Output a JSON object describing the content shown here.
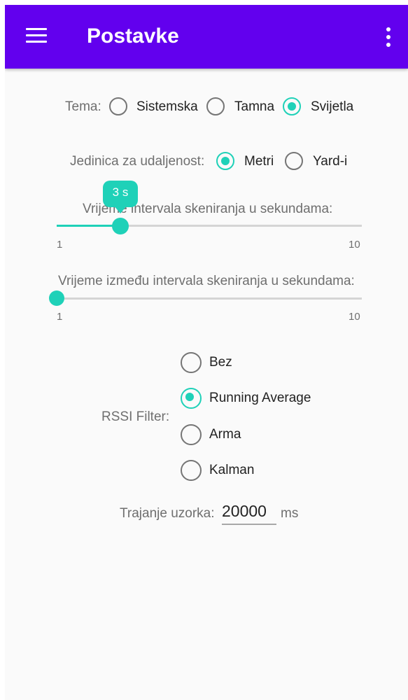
{
  "appbar": {
    "title": "Postavke"
  },
  "theme": {
    "label": "Tema:",
    "options": [
      {
        "label": "Sistemska",
        "selected": false
      },
      {
        "label": "Tamna",
        "selected": false
      },
      {
        "label": "Svijetla",
        "selected": true
      }
    ]
  },
  "distance_unit": {
    "label": "Jedinica za udaljenost:",
    "options": [
      {
        "label": "Metri",
        "selected": true
      },
      {
        "label": "Yard-i",
        "selected": false
      }
    ]
  },
  "scan_interval": {
    "label": "Vrijeme intervala skeniranja u sekundama:",
    "value_bubble": "3 s",
    "value": 3,
    "min_label": "1",
    "max_label": "10"
  },
  "between_interval": {
    "label": "Vrijeme između intervala skeniranja u sekundama:",
    "value": 1,
    "min_label": "1",
    "max_label": "10"
  },
  "rssi_filter": {
    "label": "RSSI Filter:",
    "options": [
      {
        "label": "Bez",
        "selected": false
      },
      {
        "label": "Running Average",
        "selected": true
      },
      {
        "label": "Arma",
        "selected": false
      },
      {
        "label": "Kalman",
        "selected": false
      }
    ]
  },
  "sample_duration": {
    "label": "Trajanje uzorka:",
    "value": "20000",
    "unit": "ms"
  },
  "colors": {
    "primary": "#6200ee",
    "accent": "#1fd1b8"
  }
}
